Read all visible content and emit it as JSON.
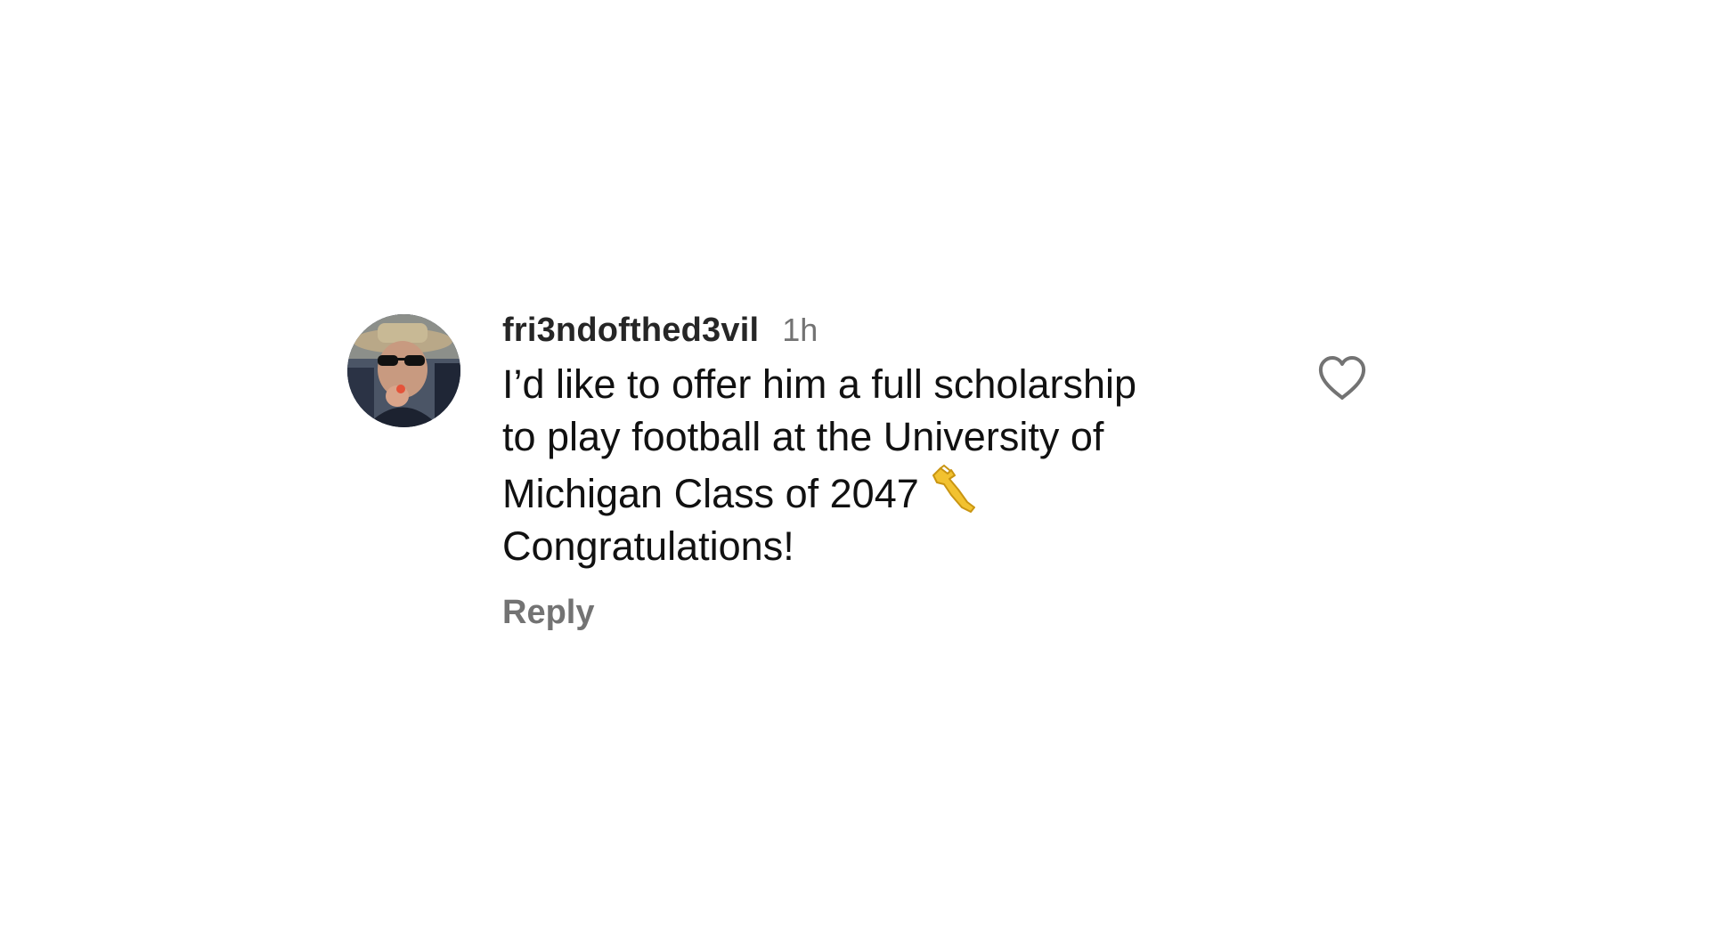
{
  "comment": {
    "avatar_icon": "user-avatar-photo",
    "username": "fri3ndofthed3vil",
    "timestamp": "1h",
    "text_lines": [
      "I’d like to offer him a full scholarship",
      "to play football at the University of",
      "Michigan Class of 2047",
      "Congratulations!"
    ],
    "emoji": "flexed-biceps-icon",
    "reply_label": "Reply",
    "like_icon": "heart-outline-icon"
  },
  "colors": {
    "background": "#ffffff",
    "username": "#262626",
    "timestamp": "#737373",
    "body": "#111111",
    "reply": "#737373",
    "heart_stroke": "#737373",
    "emoji": "#f2c230"
  }
}
